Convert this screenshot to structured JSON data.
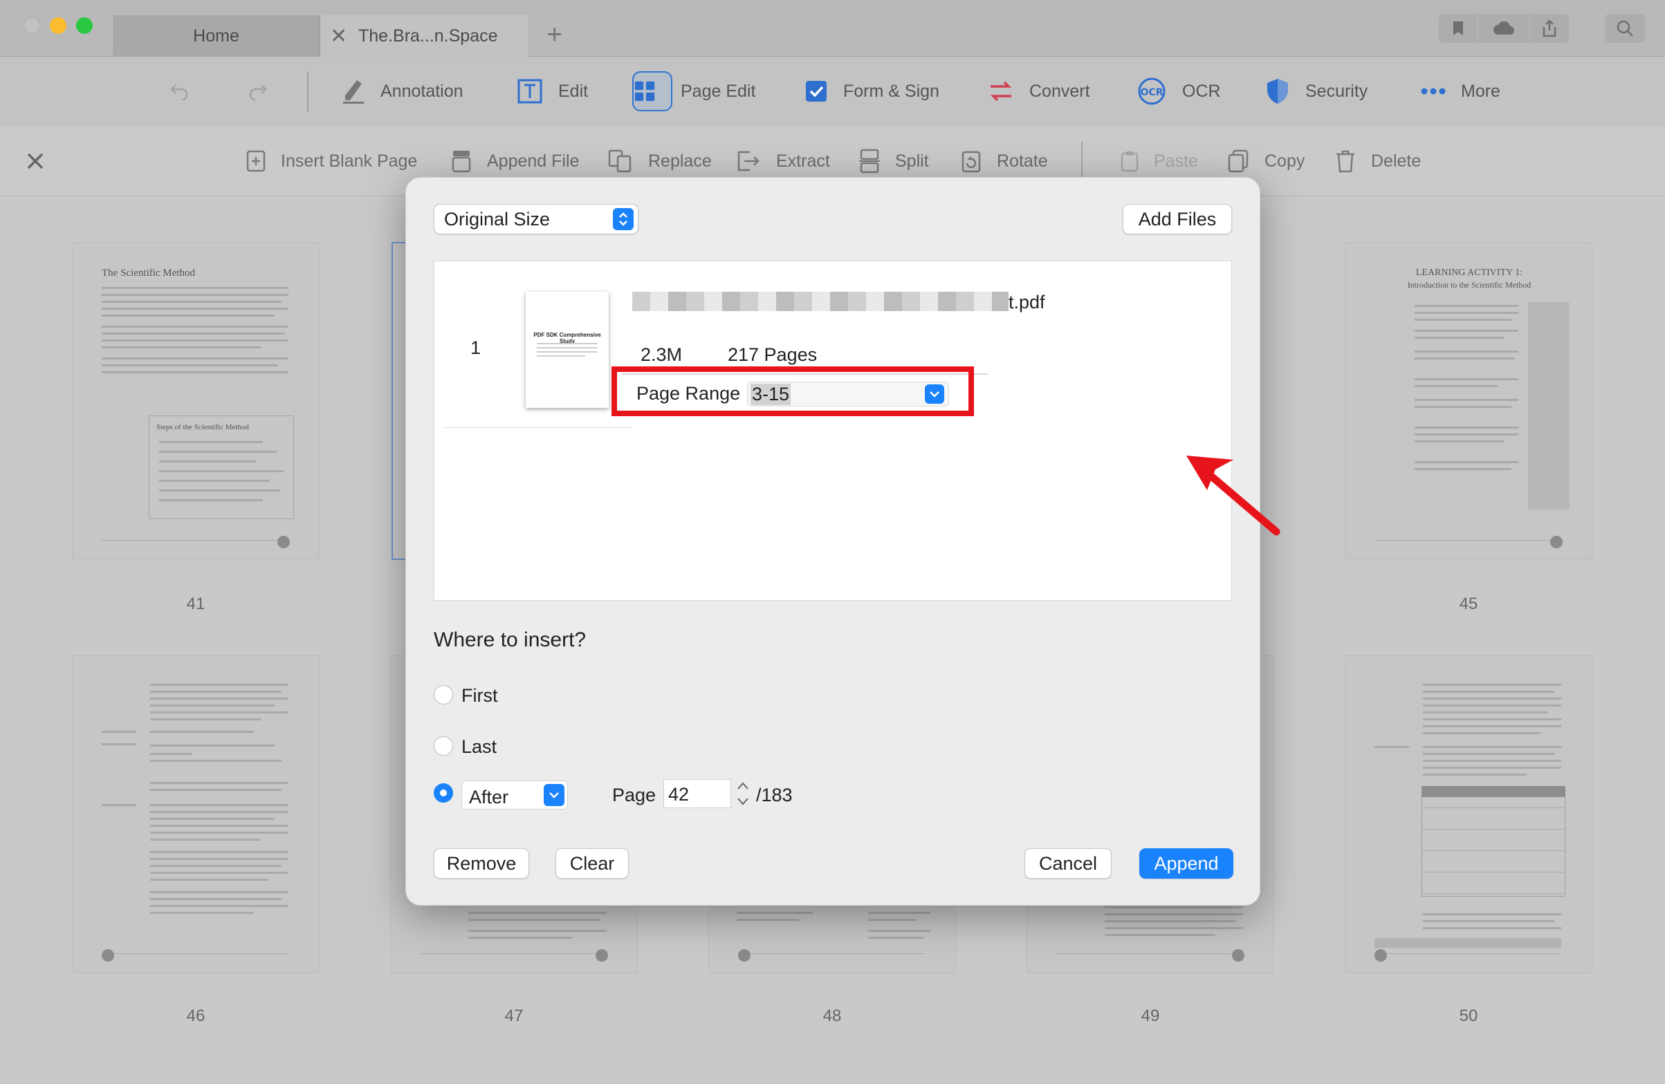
{
  "tabs": [
    {
      "label": "Home"
    },
    {
      "label": "The.Bra...n.Space"
    }
  ],
  "toolbar": {
    "annotation": "Annotation",
    "edit": "Edit",
    "page_edit": "Page Edit",
    "form_sign": "Form & Sign",
    "convert": "Convert",
    "ocr": "OCR",
    "security": "Security",
    "more": "More"
  },
  "pagebar": {
    "insert_blank": "Insert Blank Page",
    "append_file": "Append File",
    "replace": "Replace",
    "extract": "Extract",
    "split": "Split",
    "rotate": "Rotate",
    "paste": "Paste",
    "copy": "Copy",
    "delete": "Delete"
  },
  "thumbnails": {
    "p41_title": "The Scientific Method",
    "p41_box_title": "Steps of the Scientific Method",
    "p45_title": "LEARNING ACTIVITY 1:",
    "p45_subtitle": "Introduction to the Scientific Method",
    "numbers": [
      "41",
      "45",
      "46",
      "47",
      "48",
      "49",
      "50"
    ]
  },
  "dialog": {
    "size_select": "Original Size",
    "add_files": "Add Files",
    "file": {
      "index": "1",
      "name_suffix": "t.pdf",
      "size": "2.3M",
      "pages": "217 Pages",
      "thumb_title": "PDF SDK Comprehensive Study"
    },
    "page_range_label": "Page Range",
    "page_range_value": "3-15",
    "where_label": "Where to insert?",
    "options": {
      "first": "First",
      "last": "Last",
      "after": "After"
    },
    "page_label": "Page",
    "page_value": "42",
    "page_total": "/183",
    "remove": "Remove",
    "clear": "Clear",
    "cancel": "Cancel",
    "append": "Append"
  },
  "colors": {
    "accent": "#1a82fb",
    "highlight": "#e8141b"
  }
}
